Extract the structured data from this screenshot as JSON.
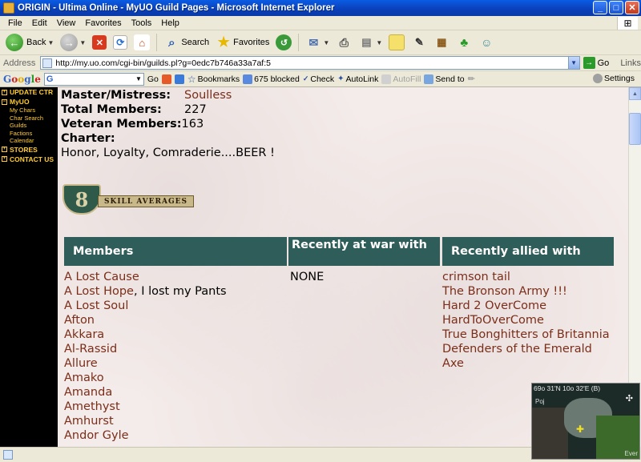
{
  "window": {
    "title": "ORIGIN - Ultima Online - MyUO Guild Pages - Microsoft Internet Explorer",
    "btn_min": "_",
    "btn_max": "□",
    "btn_close": "✕"
  },
  "menu": {
    "items": [
      "File",
      "Edit",
      "View",
      "Favorites",
      "Tools",
      "Help"
    ]
  },
  "toolbar": {
    "back_label": "Back",
    "search_label": "Search",
    "favorites_label": "Favorites"
  },
  "address": {
    "label": "Address",
    "url": "http://my.uo.com/cgi-bin/guilds.pl?g=0edc7b746a33a7af:5",
    "go_label": "Go",
    "links_label": "Links"
  },
  "googlebar": {
    "go_label": "Go",
    "bookmarks_label": "Bookmarks",
    "blocked_label": "675 blocked",
    "check_label": "Check",
    "autolink_label": "AutoLink",
    "autofill_label": "AutoFill",
    "sendto_label": "Send to",
    "settings_label": "Settings"
  },
  "nav": {
    "update_ctr": "UPDATE CTR",
    "myuo": "MyUO",
    "my_chars": "My Chars",
    "char_search": "Char Search",
    "guilds": "Guilds",
    "factions": "Factions",
    "calendar": "Calendar",
    "stores": "STORES",
    "contact_us": "CONTACT US"
  },
  "guild": {
    "master_label": "Master/Mistress:",
    "master_value": "Soulless",
    "total_label": "Total Members:",
    "total_value": "227",
    "veteran_label": "Veteran Members:",
    "veteran_value": "163",
    "charter_label": "Charter:",
    "charter_value": "Honor, Loyalty, Comraderie....BEER !"
  },
  "skill_banner": {
    "number": "8",
    "label": "SKILL AVERAGES"
  },
  "table": {
    "members_header": "Members",
    "war_header": "Recently at war with",
    "allied_header": "Recently allied with",
    "members": [
      {
        "name": "A Lost Cause",
        "note": ""
      },
      {
        "name": "A Lost Hope",
        "note": ", I lost my Pants"
      },
      {
        "name": "A Lost Soul",
        "note": ""
      },
      {
        "name": "Afton",
        "note": ""
      },
      {
        "name": "Akkara",
        "note": ""
      },
      {
        "name": "Al-Rassid",
        "note": ""
      },
      {
        "name": "Allure",
        "note": ""
      },
      {
        "name": "Amako",
        "note": ""
      },
      {
        "name": "Amanda",
        "note": ""
      },
      {
        "name": "Amethyst",
        "note": ""
      },
      {
        "name": "Amhurst",
        "note": ""
      },
      {
        "name": "Andor Gyle",
        "note": ""
      }
    ],
    "war": [
      "NONE"
    ],
    "allied": [
      "crimson tail",
      "The Bronson Army !!!",
      "Hard 2 OverCome",
      "HardToOverCome",
      "True Bonghitters of Britannia",
      "Defenders of the Emerald Axe"
    ]
  },
  "minimap": {
    "coords": "69o 31'N 10o 32'E (B)",
    "label_poj": "Poj",
    "label_ever": "Ever"
  }
}
